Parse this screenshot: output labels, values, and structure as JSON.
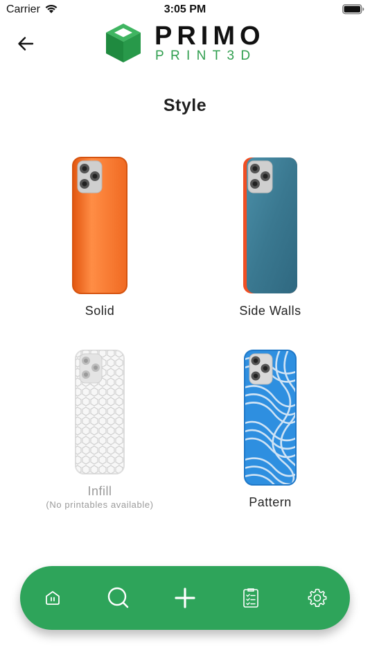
{
  "status_bar": {
    "carrier": "Carrier",
    "time": "3:05 PM"
  },
  "header": {
    "back_icon": "arrow-left-icon",
    "logo": {
      "line1": "PRIMO",
      "line2": "PRINT3D",
      "brand_color": "#2f9e4e"
    }
  },
  "page_title": "Style",
  "styles": [
    {
      "label": "Solid",
      "note": "",
      "enabled": true,
      "colors": [
        "#f46a1e",
        "#ff8a3a"
      ]
    },
    {
      "label": "Side Walls",
      "note": "",
      "enabled": true,
      "colors": [
        "#3f7f97",
        "#f04e23"
      ]
    },
    {
      "label": "Infill",
      "note": "(No printables available)",
      "enabled": false,
      "colors": [
        "#f2f2f2",
        "#d6d6d6"
      ]
    },
    {
      "label": "Pattern",
      "note": "",
      "enabled": true,
      "colors": [
        "#2e8fe0",
        "#b9d7f2"
      ]
    }
  ],
  "bottom_nav": {
    "color": "#2ea45a",
    "items": [
      {
        "icon": "home-icon"
      },
      {
        "icon": "search-icon"
      },
      {
        "icon": "plus-icon"
      },
      {
        "icon": "checklist-icon"
      },
      {
        "icon": "gear-icon"
      }
    ]
  }
}
